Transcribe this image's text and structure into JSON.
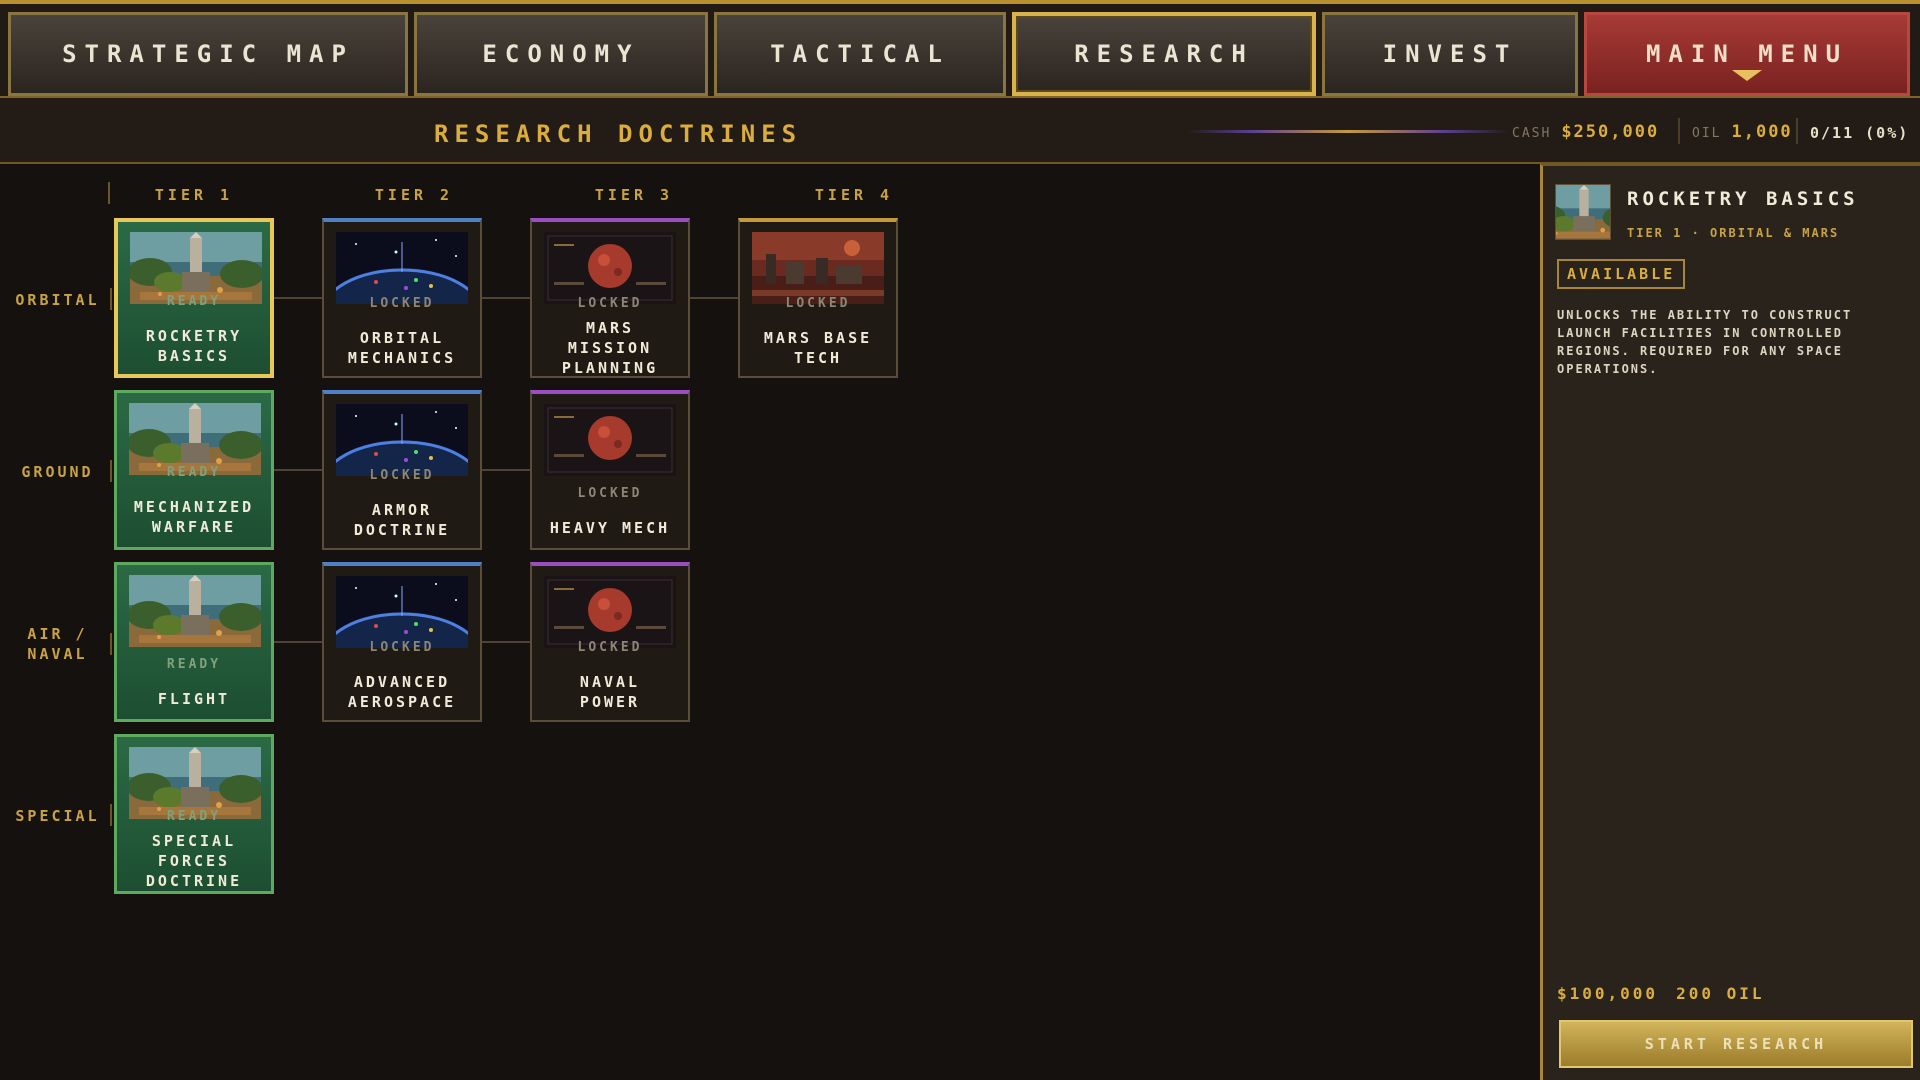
{
  "nav": {
    "tabs": [
      {
        "label": "STRATEGIC MAP"
      },
      {
        "label": "ECONOMY"
      },
      {
        "label": "TACTICAL"
      },
      {
        "label": "RESEARCH"
      },
      {
        "label": "INVEST"
      }
    ],
    "active_tab": "RESEARCH",
    "main_menu": "MAIN MENU"
  },
  "header": {
    "title": "RESEARCH DOCTRINES",
    "cash_label": "CASH",
    "cash_value": "$250,000",
    "oil_label": "OIL",
    "oil_value": "1,000",
    "progress": "0/11 (0%)"
  },
  "tree": {
    "tiers": [
      "TIER 1",
      "TIER 2",
      "TIER 3",
      "TIER 4"
    ],
    "rows": [
      {
        "label_lines": [
          "ORBITAL"
        ],
        "nodes": [
          {
            "status": "READY",
            "name_lines": [
              "ROCKETRY",
              "BASICS"
            ]
          },
          {
            "status": "LOCKED",
            "name_lines": [
              "ORBITAL",
              "MECHANICS"
            ]
          },
          {
            "status": "LOCKED",
            "name_lines": [
              "MARS",
              "MISSION",
              "PLANNING"
            ]
          },
          {
            "status": "LOCKED",
            "name_lines": [
              "MARS BASE",
              "TECH"
            ]
          }
        ]
      },
      {
        "label_lines": [
          "GROUND"
        ],
        "nodes": [
          {
            "status": "READY",
            "name_lines": [
              "MECHANIZED",
              "WARFARE"
            ]
          },
          {
            "status": "LOCKED",
            "name_lines": [
              "ARMOR",
              "DOCTRINE"
            ]
          },
          {
            "status": "LOCKED",
            "name_lines": [
              "HEAVY MECH"
            ]
          }
        ]
      },
      {
        "label_lines": [
          "AIR /",
          "NAVAL"
        ],
        "nodes": [
          {
            "status": "READY",
            "name_lines": [
              "FLIGHT"
            ]
          },
          {
            "status": "LOCKED",
            "name_lines": [
              "ADVANCED",
              "AEROSPACE"
            ]
          },
          {
            "status": "LOCKED",
            "name_lines": [
              "NAVAL",
              "POWER"
            ]
          }
        ]
      },
      {
        "label_lines": [
          "SPECIAL"
        ],
        "nodes": [
          {
            "status": "READY",
            "name_lines": [
              "SPECIAL",
              "FORCES",
              "DOCTRINE"
            ]
          }
        ]
      }
    ]
  },
  "detail": {
    "title": "ROCKETRY BASICS",
    "subtitle": "TIER 1 · ORBITAL & MARS",
    "badge": "AVAILABLE",
    "description": "UNLOCKS THE ABILITY TO CONSTRUCT LAUNCH FACILITIES IN CONTROLLED REGIONS. REQUIRED FOR ANY SPACE OPERATIONS.",
    "cost_cash": "$100,000",
    "cost_oil": "200 OIL",
    "start_button": "START RESEARCH"
  },
  "colors": {
    "gold": "#dbad3f",
    "ready_green": "#2b6a45",
    "tier2_blue": "#4f7fc4",
    "tier3_purple": "#9b4ec2",
    "menu_red": "#a73a35"
  }
}
